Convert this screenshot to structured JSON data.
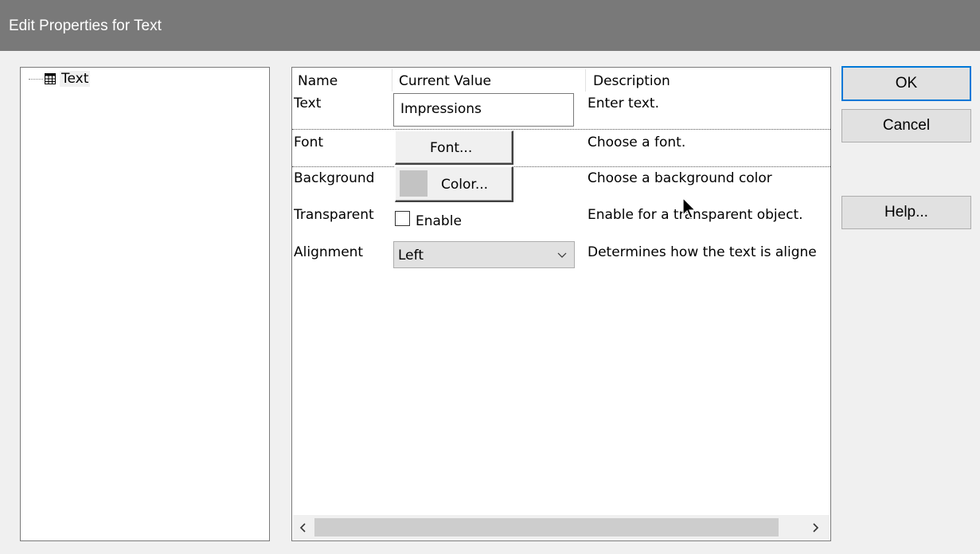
{
  "window": {
    "title": "Edit Properties for Text"
  },
  "tree": {
    "items": [
      {
        "label": "Text"
      }
    ]
  },
  "grid": {
    "columns": [
      "Name",
      "Current Value",
      "Description"
    ],
    "rows": [
      {
        "name": "Text",
        "value": "Impressions",
        "description": "Enter text."
      },
      {
        "name": "Font",
        "button": "Font...",
        "description": "Choose a font."
      },
      {
        "name": "Background",
        "button": "Color...",
        "description": "Choose a background color",
        "swatch_color": "#c3c3c3"
      },
      {
        "name": "Transparent",
        "checkbox_label": "Enable",
        "checked": false,
        "description": "Enable for a transparent object."
      },
      {
        "name": "Alignment",
        "selected": "Left",
        "description": "Determines how the text is aligne"
      }
    ]
  },
  "buttons": {
    "ok": "OK",
    "cancel": "Cancel",
    "help": "Help..."
  },
  "colors": {
    "titlebar": "#797979",
    "focus_border": "#0078d7",
    "dialog_bg": "#f0f0f0"
  }
}
